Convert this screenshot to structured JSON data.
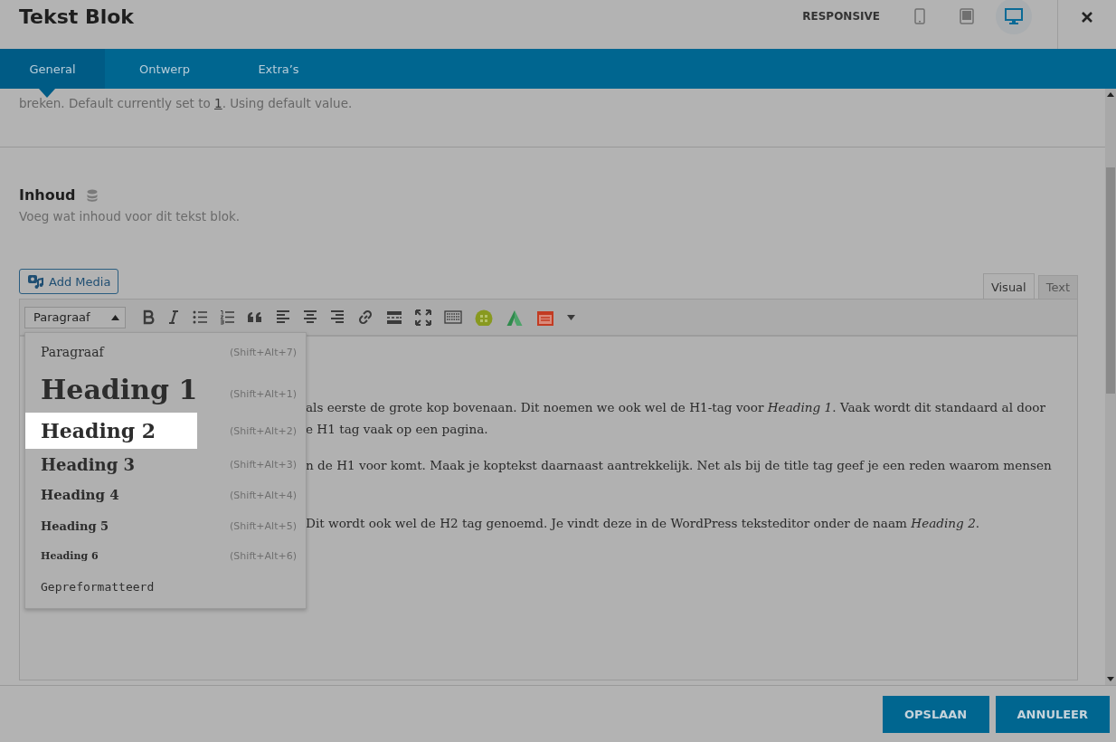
{
  "window": {
    "title": "Tekst Blok",
    "responsive_label": "RESPONSIVE"
  },
  "devices": [
    {
      "kind": "phone",
      "selected": false
    },
    {
      "kind": "tablet",
      "selected": false
    },
    {
      "kind": "desktop",
      "selected": true
    }
  ],
  "tabs": [
    {
      "label": "General",
      "selected": true
    },
    {
      "label": "Ontwerp",
      "selected": false
    },
    {
      "label": "Extra’s",
      "selected": false
    }
  ],
  "option_help": {
    "before": "breken. Default currently set to ",
    "link": "1",
    "after": ". Using default value."
  },
  "field": {
    "label": "Inhoud",
    "description": "Voeg wat inhoud voor dit tekst blok."
  },
  "add_media": "Add Media",
  "editor_tabs": [
    {
      "label": "Visual",
      "selected": true
    },
    {
      "label": "Text",
      "selected": false
    }
  ],
  "format_select": "Paragraaf",
  "format_menu": [
    {
      "kind": "p",
      "label": "Paragraaf",
      "shortcut": "(Shift+Alt+7)",
      "selected": false
    },
    {
      "kind": "h1",
      "label": "Heading 1",
      "shortcut": "(Shift+Alt+1)",
      "selected": false
    },
    {
      "kind": "h2",
      "label": "Heading 2",
      "shortcut": "(Shift+Alt+2)",
      "selected": true
    },
    {
      "kind": "h3",
      "label": "Heading 3",
      "shortcut": "(Shift+Alt+3)",
      "selected": false
    },
    {
      "kind": "h4",
      "label": "Heading 4",
      "shortcut": "(Shift+Alt+4)",
      "selected": false
    },
    {
      "kind": "h5",
      "label": "Heading 5",
      "shortcut": "(Shift+Alt+5)",
      "selected": false
    },
    {
      "kind": "h6",
      "label": "Heading 6",
      "shortcut": "(Shift+Alt+6)",
      "selected": false
    },
    {
      "kind": "pre",
      "label": "Gepreformatteerd",
      "selected": false
    }
  ],
  "editor_paragraphs": [
    {
      "lines": [
        "als eerste de grote kop bovenaan. Dit noemen we ook wel de H1-tag voor *Heading 1*. Vaak wordt dit standaard al door",
        "e H1 tag vaak op een pagina."
      ]
    },
    {
      "lines": [
        "n de H1 voor komt. Maak je koptekst daarnaast aantrekkelijk. Net als bij de title tag geef je een reden waarom mensen"
      ]
    },
    {
      "lines": [
        "Dit wordt ook wel de H2 tag genoemd. Je vindt deze in de WordPress teksteditor onder de naam *Heading 2*."
      ]
    }
  ],
  "buttons": [
    {
      "label": "OPSLAAN"
    },
    {
      "label": "ANNULEER"
    }
  ]
}
